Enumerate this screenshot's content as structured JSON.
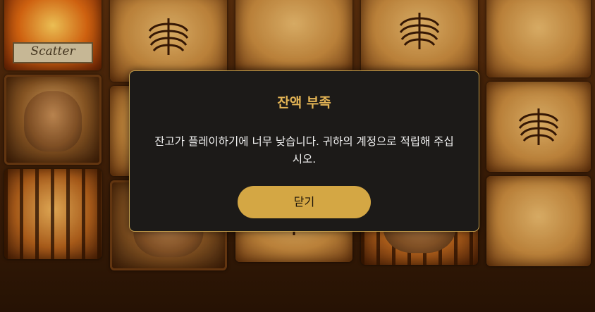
{
  "dialog": {
    "title": "잔액 부족",
    "message": "잔고가 플레이하기에 너무 낮습니다. 귀하의 계정으로 적립해 주십시오.",
    "close_label": "닫기"
  },
  "reels": {
    "scatter_label": "Scatter"
  },
  "colors": {
    "title_gold": "#e3b455",
    "button_gold": "#d4a744",
    "dialog_bg": "#1c1a18",
    "dialog_border": "#c7a24e"
  }
}
